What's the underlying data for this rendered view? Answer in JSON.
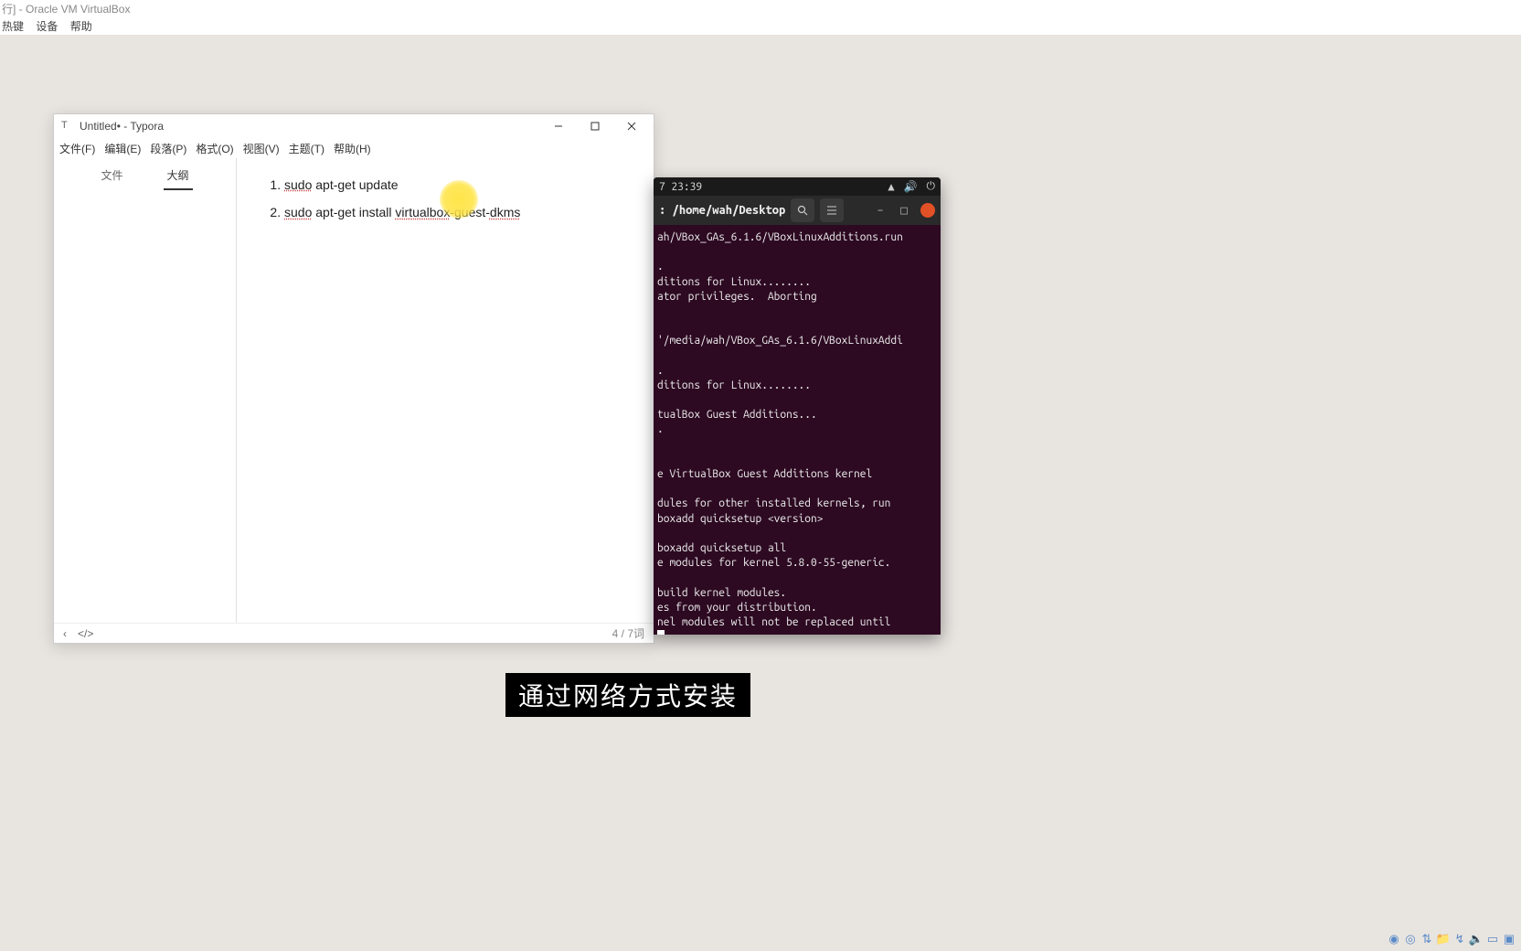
{
  "virtualbox": {
    "title": "行] - Oracle VM VirtualBox",
    "menu": [
      "热键",
      "设备",
      "帮助"
    ]
  },
  "typora": {
    "caption_icon": "T",
    "title": "Untitled• - Typora",
    "menu": [
      "文件(F)",
      "编辑(E)",
      "段落(P)",
      "格式(O)",
      "视图(V)",
      "主题(T)",
      "帮助(H)"
    ],
    "side_tabs": {
      "file": "文件",
      "outline": "大纲"
    },
    "doc_items": [
      {
        "parts": [
          {
            "text": "sudo",
            "squig": true
          },
          {
            "text": " apt-get update",
            "squig": false
          }
        ]
      },
      {
        "parts": [
          {
            "text": "sudo",
            "squig": true
          },
          {
            "text": " apt-get install ",
            "squig": false
          },
          {
            "text": "virtualbox",
            "squig": true
          },
          {
            "text": "-guest-",
            "squig": false
          },
          {
            "text": "dkms",
            "squig": true
          }
        ]
      }
    ],
    "status_left_back": "‹",
    "status_left_code": "</>",
    "status_right": "4 / 7词"
  },
  "terminal": {
    "top_time": "7 23:39",
    "header_title": ": /home/wah/Desktop",
    "lines": [
      "ah/VBox_GAs_6.1.6/VBoxLinuxAdditions.run",
      "",
      ".",
      "ditions for Linux........",
      "ator privileges.  Aborting",
      "",
      "",
      "'/media/wah/VBox_GAs_6.1.6/VBoxLinuxAddi",
      "",
      ".",
      "ditions for Linux........",
      "",
      "tualBox Guest Additions...",
      ".",
      "",
      "",
      "e VirtualBox Guest Additions kernel",
      "",
      "dules for other installed kernels, run",
      "boxadd quicksetup <version>",
      "",
      "boxadd quicksetup all",
      "e modules for kernel 5.8.0-55-generic.",
      "",
      "build kernel modules.",
      "es from your distribution.",
      "nel modules will not be replaced until",
      ""
    ]
  },
  "subtitle": "通过网络方式安装",
  "tray_icons": [
    "disc",
    "dot",
    "usb",
    "folder",
    "net",
    "speaker",
    "screen",
    "screen2"
  ]
}
